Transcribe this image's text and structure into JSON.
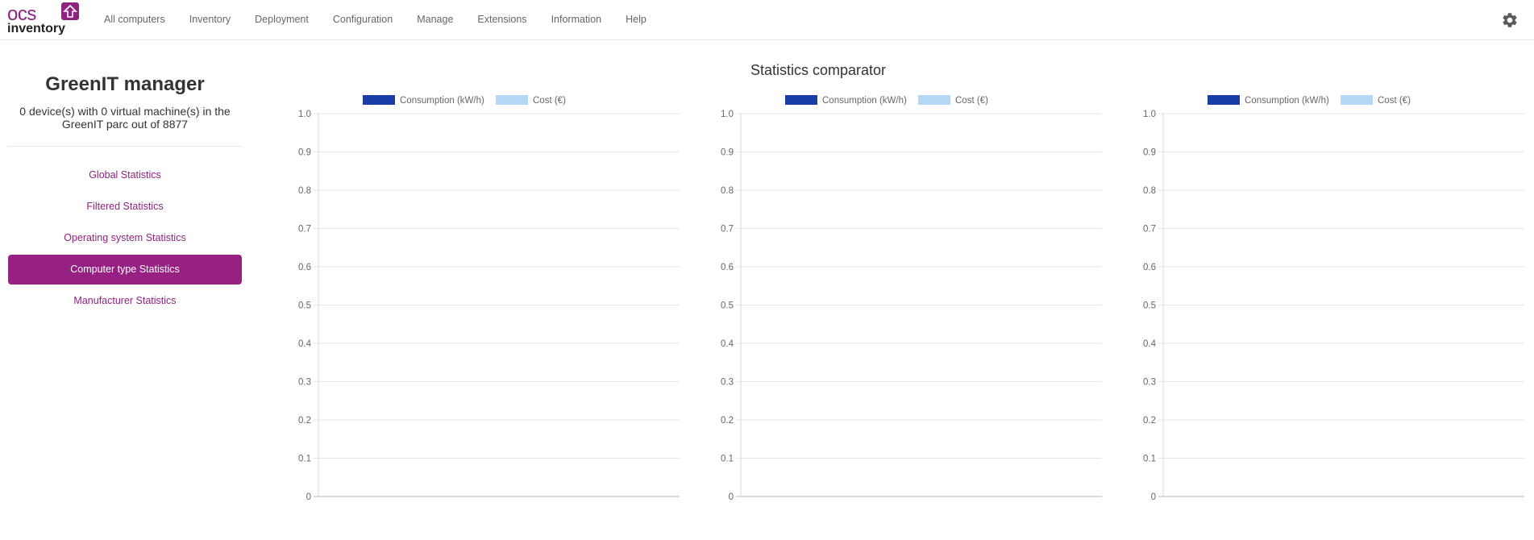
{
  "brand": {
    "logo_top": "ocs",
    "logo_bottom": "inventory",
    "logo_color": "#902281"
  },
  "nav": {
    "items": [
      {
        "label": "All computers",
        "name": "nav-all-computers"
      },
      {
        "label": "Inventory",
        "name": "nav-inventory"
      },
      {
        "label": "Deployment",
        "name": "nav-deployment"
      },
      {
        "label": "Configuration",
        "name": "nav-configuration"
      },
      {
        "label": "Manage",
        "name": "nav-manage"
      },
      {
        "label": "Extensions",
        "name": "nav-extensions"
      },
      {
        "label": "Information",
        "name": "nav-information"
      },
      {
        "label": "Help",
        "name": "nav-help"
      }
    ],
    "settings_icon": "gear-icon"
  },
  "sidebar": {
    "title": "GreenIT manager",
    "summary": "0 device(s) with 0 virtual machine(s) in the GreenIT parc out of 8877",
    "items": [
      {
        "label": "Global Statistics",
        "name": "sidebar-item-global-statistics",
        "active": false
      },
      {
        "label": "Filtered Statistics",
        "name": "sidebar-item-filtered-statistics",
        "active": false
      },
      {
        "label": "Operating system Statistics",
        "name": "sidebar-item-os-statistics",
        "active": false
      },
      {
        "label": "Computer type Statistics",
        "name": "sidebar-item-computer-type-statistics",
        "active": true
      },
      {
        "label": "Manufacturer Statistics",
        "name": "sidebar-item-manufacturer-statistics",
        "active": false
      }
    ],
    "accent_color": "#972083"
  },
  "main": {
    "title": "Statistics comparator"
  },
  "chart_data": [
    {
      "type": "bar",
      "categories": [],
      "series": [
        {
          "name": "Consumption (kW/h)",
          "values": [],
          "color": "#1a3ea6"
        },
        {
          "name": "Cost (€)",
          "values": [],
          "color": "#b3d7f5"
        }
      ],
      "ylim": [
        0,
        1
      ],
      "yticks": [
        "0",
        "0.1",
        "0.2",
        "0.3",
        "0.4",
        "0.5",
        "0.6",
        "0.7",
        "0.8",
        "0.9",
        "1.0"
      ],
      "grid": true,
      "legend": "top"
    },
    {
      "type": "bar",
      "categories": [],
      "series": [
        {
          "name": "Consumption (kW/h)",
          "values": [],
          "color": "#1a3ea6"
        },
        {
          "name": "Cost (€)",
          "values": [],
          "color": "#b3d7f5"
        }
      ],
      "ylim": [
        0,
        1
      ],
      "yticks": [
        "0",
        "0.1",
        "0.2",
        "0.3",
        "0.4",
        "0.5",
        "0.6",
        "0.7",
        "0.8",
        "0.9",
        "1.0"
      ],
      "grid": true,
      "legend": "top"
    },
    {
      "type": "bar",
      "categories": [],
      "series": [
        {
          "name": "Consumption (kW/h)",
          "values": [],
          "color": "#1a3ea6"
        },
        {
          "name": "Cost (€)",
          "values": [],
          "color": "#b3d7f5"
        }
      ],
      "ylim": [
        0,
        1
      ],
      "yticks": [
        "0",
        "0.1",
        "0.2",
        "0.3",
        "0.4",
        "0.5",
        "0.6",
        "0.7",
        "0.8",
        "0.9",
        "1.0"
      ],
      "grid": true,
      "legend": "top"
    }
  ]
}
